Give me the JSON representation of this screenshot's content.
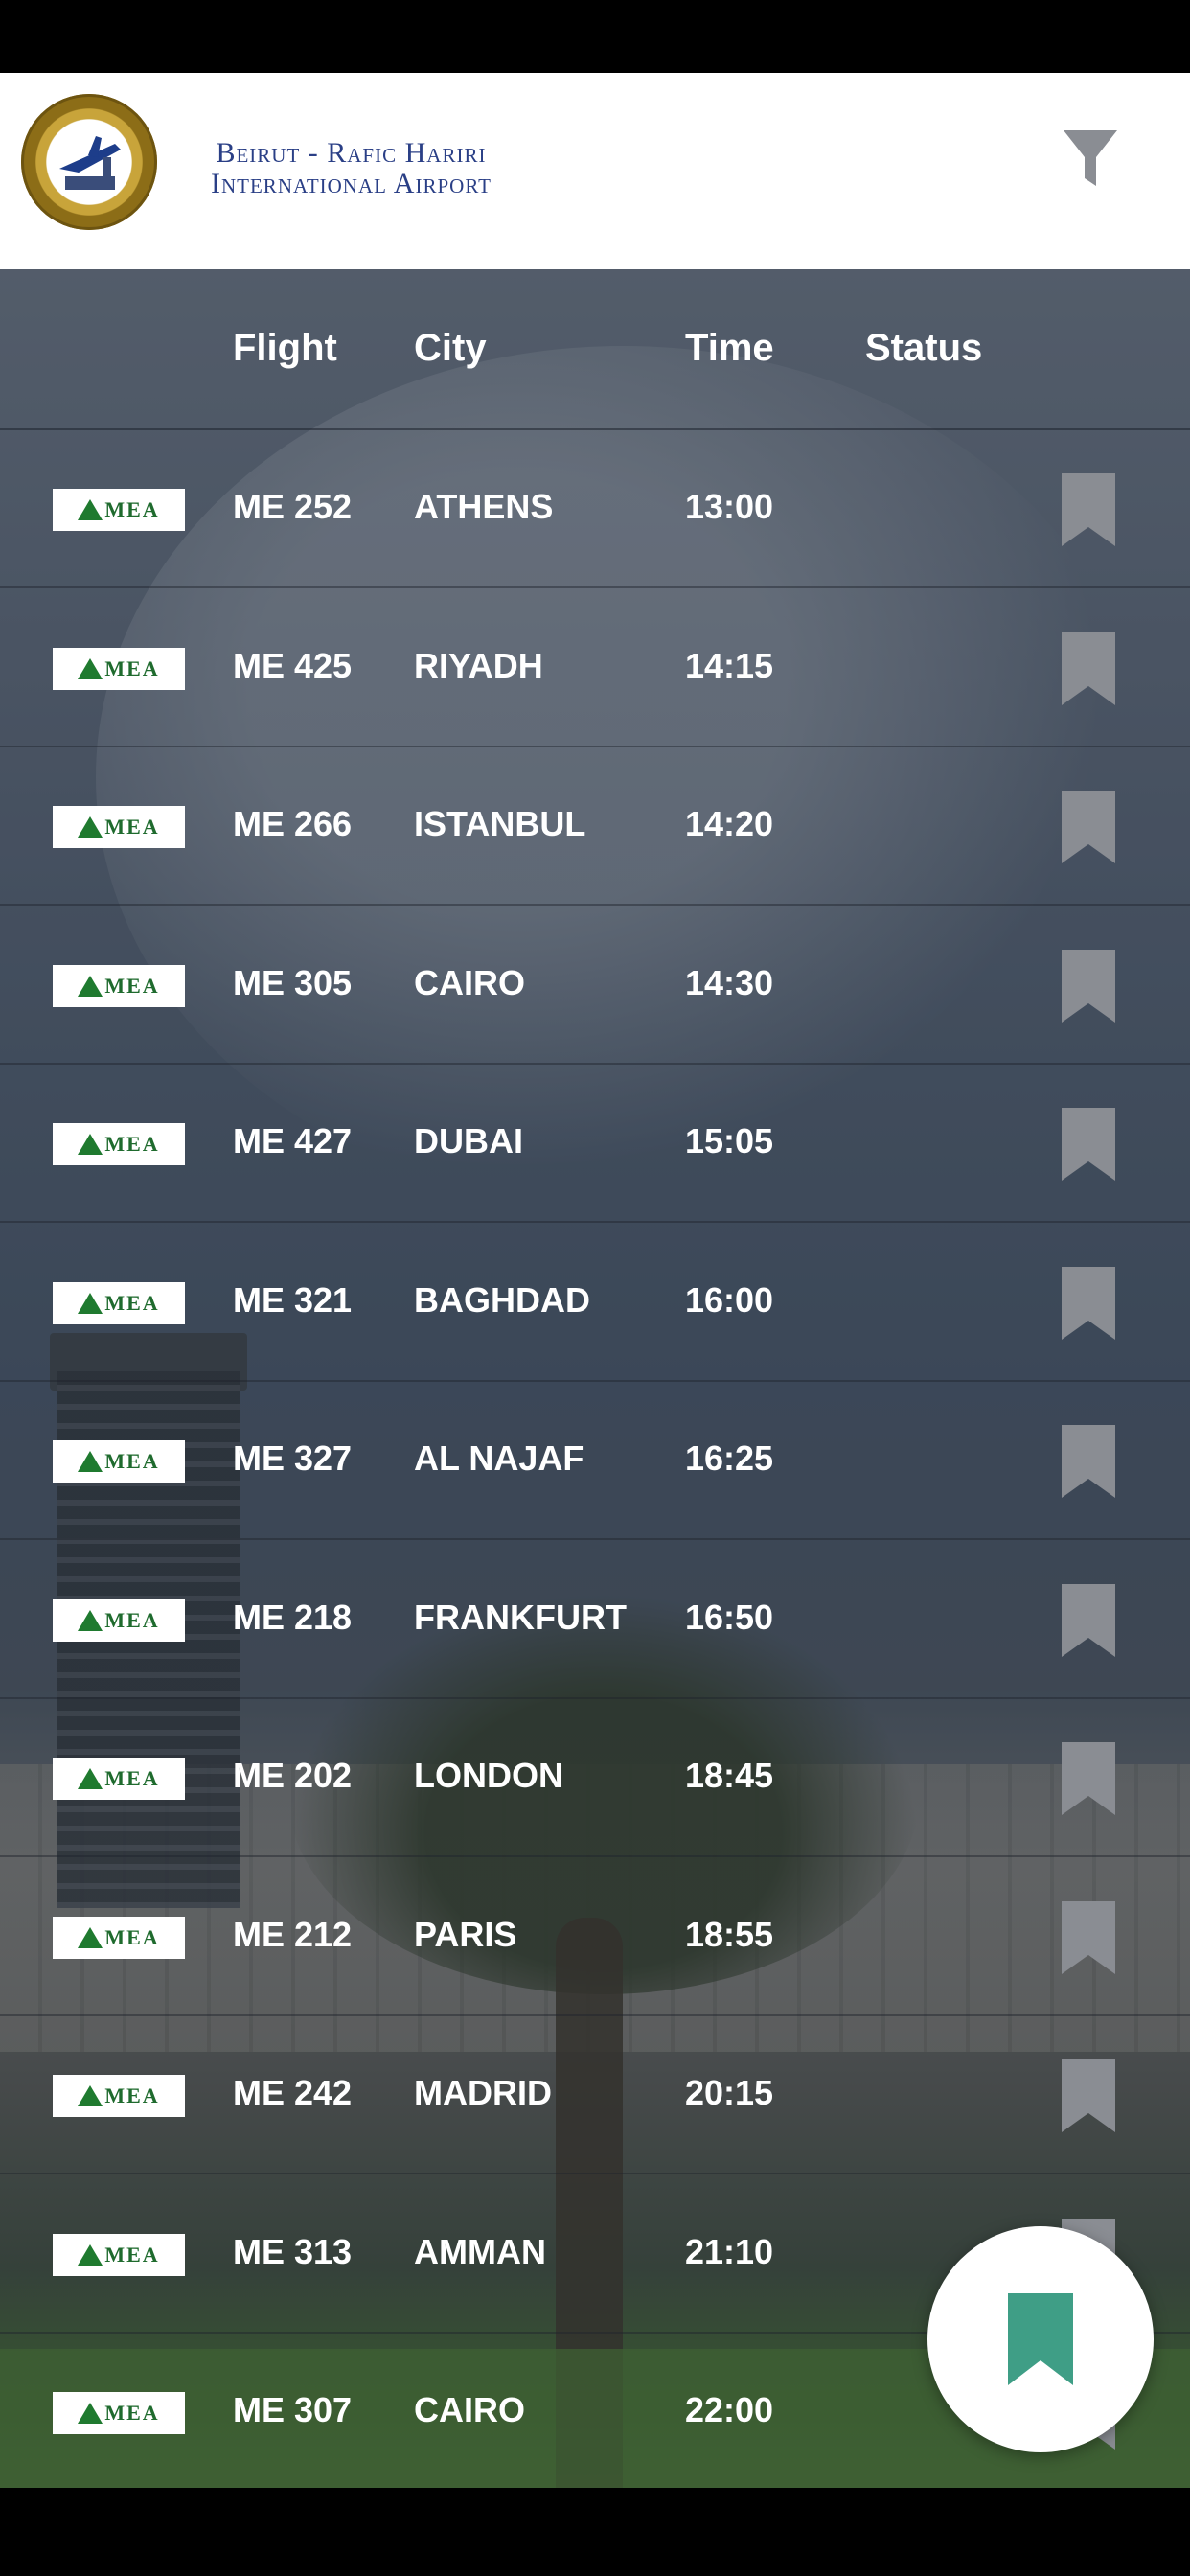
{
  "header": {
    "airport_name_line1": "Beirut - Rafic Hariri",
    "airport_name_line2": "International Airport",
    "logo_icon": "airport-seal-icon",
    "filter_icon": "filter-icon"
  },
  "columns": {
    "flight": "Flight",
    "city": "City",
    "time": "Time",
    "status": "Status"
  },
  "flights": [
    {
      "airline": "MEA",
      "flight": "ME 252",
      "city": "ATHENS",
      "time": "13:00",
      "status": ""
    },
    {
      "airline": "MEA",
      "flight": "ME 425",
      "city": "RIYADH",
      "time": "14:15",
      "status": ""
    },
    {
      "airline": "MEA",
      "flight": "ME 266",
      "city": "ISTANBUL",
      "time": "14:20",
      "status": ""
    },
    {
      "airline": "MEA",
      "flight": "ME 305",
      "city": "CAIRO",
      "time": "14:30",
      "status": ""
    },
    {
      "airline": "MEA",
      "flight": "ME 427",
      "city": "DUBAI",
      "time": "15:05",
      "status": ""
    },
    {
      "airline": "MEA",
      "flight": "ME 321",
      "city": "BAGHDAD",
      "time": "16:00",
      "status": ""
    },
    {
      "airline": "MEA",
      "flight": "ME 327",
      "city": "AL NAJAF",
      "time": "16:25",
      "status": ""
    },
    {
      "airline": "MEA",
      "flight": "ME 218",
      "city": "FRANKFURT",
      "time": "16:50",
      "status": ""
    },
    {
      "airline": "MEA",
      "flight": "ME 202",
      "city": "LONDON",
      "time": "18:45",
      "status": ""
    },
    {
      "airline": "MEA",
      "flight": "ME 212",
      "city": "PARIS",
      "time": "18:55",
      "status": ""
    },
    {
      "airline": "MEA",
      "flight": "ME 242",
      "city": "MADRID",
      "time": "20:15",
      "status": ""
    },
    {
      "airline": "MEA",
      "flight": "ME 313",
      "city": "AMMAN",
      "time": "21:10",
      "status": ""
    },
    {
      "airline": "MEA",
      "flight": "ME 307",
      "city": "CAIRO",
      "time": "22:00",
      "status": ""
    }
  ],
  "colors": {
    "bookmark_inactive": "#8a8d93",
    "bookmark_fab": "#3f9e86",
    "airport_name": "#2a3f86",
    "header_bg": "#ffffff"
  },
  "fab": {
    "icon": "bookmark-icon"
  }
}
